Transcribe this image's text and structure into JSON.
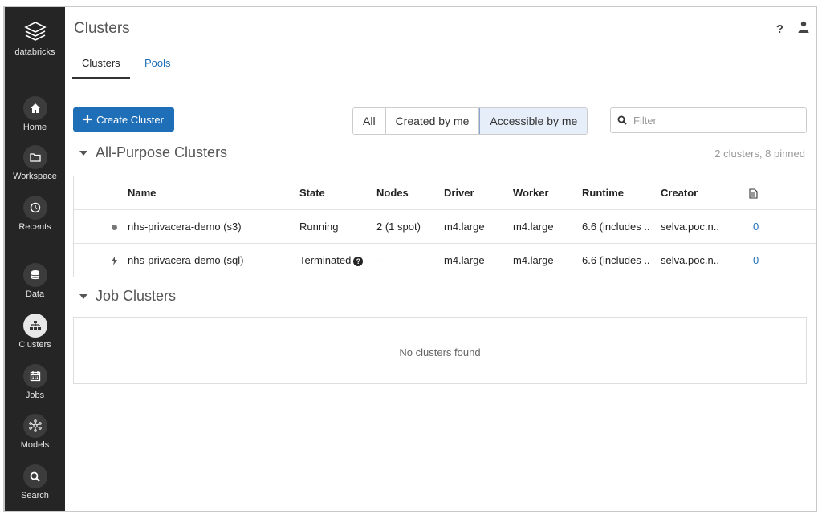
{
  "sidebar": {
    "brand": "databricks",
    "items": [
      {
        "label": "Home",
        "icon": "home-icon"
      },
      {
        "label": "Workspace",
        "icon": "folder-icon"
      },
      {
        "label": "Recents",
        "icon": "clock-icon"
      },
      {
        "label": "Data",
        "icon": "database-icon"
      },
      {
        "label": "Clusters",
        "icon": "cluster-icon",
        "active": true
      },
      {
        "label": "Jobs",
        "icon": "calendar-icon"
      },
      {
        "label": "Models",
        "icon": "models-icon"
      },
      {
        "label": "Search",
        "icon": "search-icon"
      }
    ]
  },
  "header": {
    "title": "Clusters",
    "help": "?",
    "tabs": [
      {
        "label": "Clusters",
        "active": true
      },
      {
        "label": "Pools",
        "active": false
      }
    ]
  },
  "toolbar": {
    "create_label": "Create Cluster",
    "filters": [
      "All",
      "Created by me",
      "Accessible by me"
    ],
    "active_filter": "Accessible by me",
    "search_placeholder": "Filter"
  },
  "all_purpose": {
    "title": "All-Purpose Clusters",
    "count": "2 clusters, 8 pinned",
    "columns": [
      "Name",
      "State",
      "Nodes",
      "Driver",
      "Worker",
      "Runtime",
      "Creator"
    ],
    "rows": [
      {
        "status_icon": "dot-icon",
        "name": "nhs-privacera-demo (s3)",
        "state": "Running",
        "nodes": "2 (1 spot)",
        "driver": "m4.large",
        "worker": "m4.large",
        "runtime": "6.6 (includes ..",
        "creator": "selva.poc.n..",
        "notebooks": "0"
      },
      {
        "status_icon": "lightning-icon",
        "name": "nhs-privacera-demo (sql)",
        "state": "Terminated",
        "nodes": "-",
        "driver": "m4.large",
        "worker": "m4.large",
        "runtime": "6.6 (includes ..",
        "creator": "selva.poc.n..",
        "notebooks": "0"
      }
    ]
  },
  "job_clusters": {
    "title": "Job Clusters",
    "empty_text": "No clusters found"
  },
  "colors": {
    "sidebar": "#252525",
    "accent": "#1f6fb8"
  }
}
